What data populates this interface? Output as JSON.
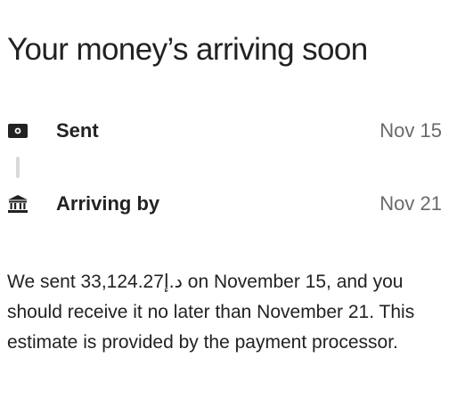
{
  "header": {
    "title": "Your money’s arriving soon"
  },
  "timeline": {
    "steps": [
      {
        "icon": "cash-icon",
        "label": "Sent",
        "date": "Nov 15"
      },
      {
        "icon": "bank-icon",
        "label": "Arriving by",
        "date": "Nov 21"
      }
    ]
  },
  "description": {
    "text": "We sent 33,124.27د.إ on November 15, and you should receive it no later than November 21. This estimate is provided by the payment processor."
  },
  "colors": {
    "text": "#222222",
    "muted": "#6a6a6a",
    "connector": "#d9d9d9"
  }
}
